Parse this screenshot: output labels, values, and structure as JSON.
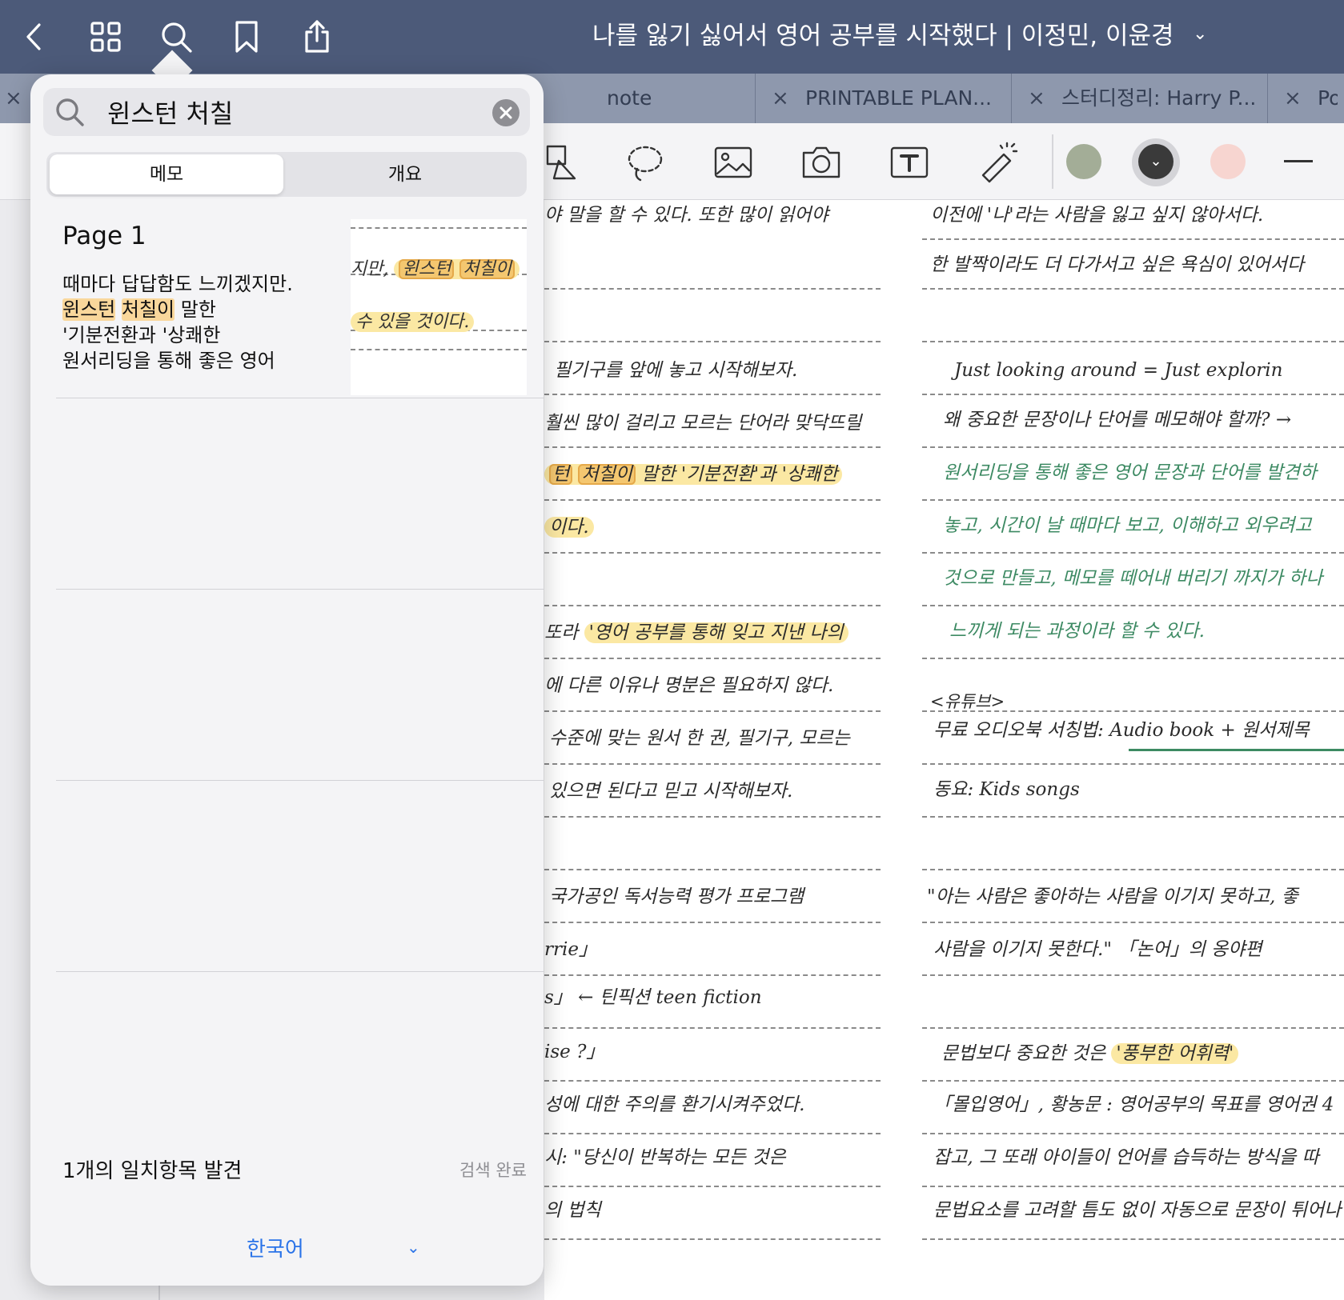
{
  "topbar": {
    "title": "나를 잃기 싫어서 영어 공부를 시작했다 | 이정민, 이윤경",
    "title_chevron": "⌄",
    "icons": [
      "back-icon",
      "grid-icon",
      "search-icon",
      "bookmark-icon",
      "share-icon"
    ]
  },
  "tabs": [
    {
      "label": "note"
    },
    {
      "label": "PRINTABLE PLAN..."
    },
    {
      "label": "스터디정리: Harry P..."
    },
    {
      "label": "Por"
    }
  ],
  "tab_close": "×",
  "toolbar": {
    "icons": [
      "shape-icon",
      "lasso-icon",
      "image-icon",
      "camera-icon",
      "text-box-icon",
      "laser-pointer-icon"
    ],
    "colors": [
      "#a3ad97",
      "#3a3a3a",
      "#f7d5d0"
    ]
  },
  "search": {
    "query": "윈스턴 처칠",
    "clear_icon": "clear-icon"
  },
  "segments": {
    "memo": "메모",
    "outline": "개요"
  },
  "result": {
    "page": "Page 1",
    "line1": "때마다 답답함도 느끼겠지만.",
    "line2_hl1": "윈스턴",
    "line2_hl2": "처칠이",
    "line2_rest": " 말한",
    "line3": "'기분전환과 '상쾌한",
    "line4": "원서리딩을 통해 좋은 영어",
    "thumb": {
      "line_a": "지만,",
      "hl_a": "윈스턴",
      "hl_b": "처칠이",
      "line_b": "수 있을 것이다."
    }
  },
  "footer": {
    "count": "1개의 일치항목 발견",
    "status": "검색 완료",
    "language": "한국어",
    "language_chevron": "⌄"
  },
  "notes_left": {
    "l1": "야 말을 할 수 있다. 또한 많이 읽어야",
    "l2": "필기구를 앞에 놓고 시작해보자.",
    "l3": "훨씬 많이 걸리고 모르는 단어라 맞닥뜨릴",
    "l4_hl1": "턴",
    "l4_hl2": "처칠이",
    "l4_rest": " 말한 '기분전환'과 '상쾌한",
    "l5": "이다.",
    "l6_pre": "또라 ",
    "l6_hl": "'영어 공부를 통해 잊고 지낸 나의",
    "l7": "에 다른 이유나 명분은 필요하지 않다.",
    "l8": "수준에 맞는 원서 한 권, 필기구, 모르는",
    "l9": "있으면 된다고 믿고 시작해보자.",
    "l10": "국가공인 독서능력 평가 프로그램",
    "l11": "rrie」",
    "l12": "s」 ← 틴픽션 teen fiction",
    "l13": "ise ?」",
    "l14": "성에 대한 주의를 환기시켜주었다.",
    "l15": "시: \"당신이 반복하는 모든 것은",
    "l16": "의 법칙"
  },
  "notes_right": {
    "r1": "이전에 '나'라는 사람을 잃고 싶지 않아서다.",
    "r2": "한 발짝이라도 더 다가서고 싶은 욕심이 있어서다",
    "r3": "Just looking around = Just explorin",
    "r4": "왜 중요한 문장이나 단어를 메모해야 할까? →",
    "r5": "원서리딩을 통해 좋은 영어 문장과 단어를 발견하",
    "r6": "놓고, 시간이 날 때마다 보고, 이해하고 외우려고",
    "r7": "것으로 만들고, 메모를 떼어내 버리기 까지가 하나",
    "r8": "느끼게 되는 과정이라 할 수 있다.",
    "r9": "<유튜브>",
    "r10": "무료 오디오북 서칭법: Audio book + 원서제목",
    "r11": "동요: Kids songs",
    "r12": "\"아는 사람은 좋아하는 사람을 이기지 못하고, 좋",
    "r13": "사람을 이기지 못한다.\" 「논어」의 옹야편",
    "r14_pre": "문법보다 중요한 것은 ",
    "r14_hl": "'풍부한 어휘력'",
    "r15": "「몰입영어」, 황농문 : 영어공부의 목표를 영어권 4",
    "r16": "잡고, 그 또래 아이들이 언어를 습득하는 방식을 따",
    "r17": "문법요소를 고려할 틈도 없이 자동으로 문장이 튀어나"
  }
}
